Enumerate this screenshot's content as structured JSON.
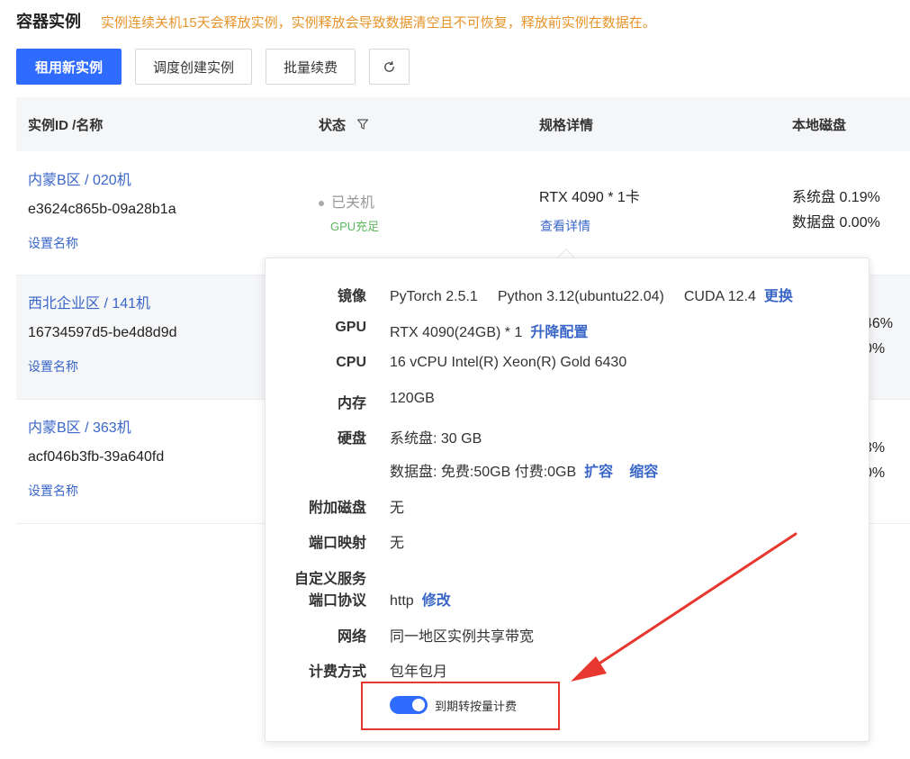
{
  "header": {
    "title": "容器实例",
    "notice": "实例连续关机15天会释放实例，实例释放会导致数据清空且不可恢复，释放前实例在数据在。"
  },
  "toolbar": {
    "rent_label": "租用新实例",
    "schedule_label": "调度创建实例",
    "batch_label": "批量续费",
    "refresh_icon": "refresh-icon"
  },
  "table": {
    "columns": [
      "实例ID /名称",
      "状态",
      "规格详情",
      "本地磁盘"
    ],
    "rows": [
      {
        "name": "内蒙B区 / 020机",
        "id": "e3624c865b-09a28b1a",
        "set_name": "设置名称",
        "status": "已关机",
        "gpu_tag": "GPU充足",
        "spec": "RTX 4090 * 1卡",
        "spec_link": "查看详情",
        "disk_sys": "系统盘 0.19%",
        "disk_data": "数据盘 0.00%"
      },
      {
        "name": "西北企业区 / 141机",
        "id": "16734597d5-be4d8d9d",
        "set_name": "设置名称",
        "disk_sys_partial": "46%",
        "disk_data_partial": "0%"
      },
      {
        "name": "内蒙B区 / 363机",
        "id": "acf046b3fb-39a640fd",
        "set_name": "设置名称",
        "disk_sys_partial": "3%",
        "disk_data_partial": "0%"
      }
    ]
  },
  "popover": {
    "image_label": "镜像",
    "image_pytorch": "PyTorch  2.5.1",
    "image_python": "Python  3.12(ubuntu22.04)",
    "image_cuda": "CUDA  12.4",
    "image_change": "更换",
    "gpu_label": "GPU",
    "gpu_value": "RTX 4090(24GB) * 1",
    "gpu_upgrade": "升降配置",
    "cpu_label": "CPU",
    "cpu_value": "16 vCPU Intel(R) Xeon(R) Gold 6430",
    "mem_label": "内存",
    "mem_value": "120GB",
    "disk_label": "硬盘",
    "disk_sys": "系统盘:  30 GB",
    "disk_data": "数据盘:  免费:50GB   付费:0GB",
    "disk_expand": "扩容",
    "disk_shrink": "缩容",
    "extra_disk_label": "附加磁盘",
    "extra_disk_value": "无",
    "port_map_label": "端口映射",
    "port_map_value": "无",
    "custom_service_label_1": "自定义服务",
    "custom_service_label_2": "端口协议",
    "protocol_value": "http",
    "protocol_edit": "修改",
    "network_label": "网络",
    "network_value": "同一地区实例共享带宽",
    "billing_label": "计费方式",
    "billing_value": "包年包月",
    "toggle_label": "到期转按量计费",
    "toggle_on": true
  },
  "colors": {
    "primary": "#2f6bff",
    "link": "#3a66c8",
    "notice": "#e6942a",
    "success": "#5cb85c",
    "annotation": "#e8372e"
  }
}
